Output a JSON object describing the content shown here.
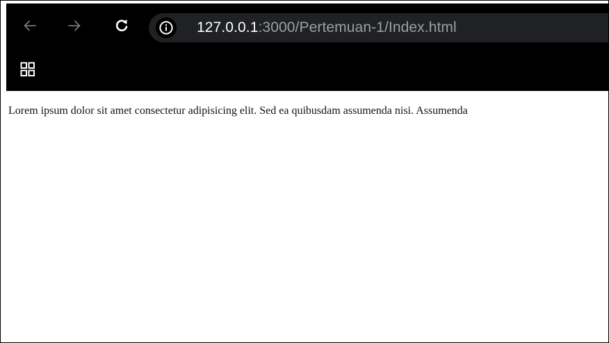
{
  "toolbar": {
    "back_icon": "arrow-left-icon",
    "forward_icon": "arrow-right-icon",
    "reload_icon": "reload-icon",
    "site_info_icon": "info-icon",
    "apps_icon": "apps-grid-icon"
  },
  "address_bar": {
    "host": "127.0.0.1",
    "rest": ":3000/Pertemuan-1/Index.html"
  },
  "page": {
    "paragraph": "Lorem ipsum dolor sit amet consectetur adipisicing elit. Sed ea quibusdam assumenda nisi. Assumenda"
  },
  "colors": {
    "chrome_background": "#000000",
    "omnibox_background": "#202124",
    "url_host": "#ffffff",
    "url_rest": "#9aa0a6"
  }
}
